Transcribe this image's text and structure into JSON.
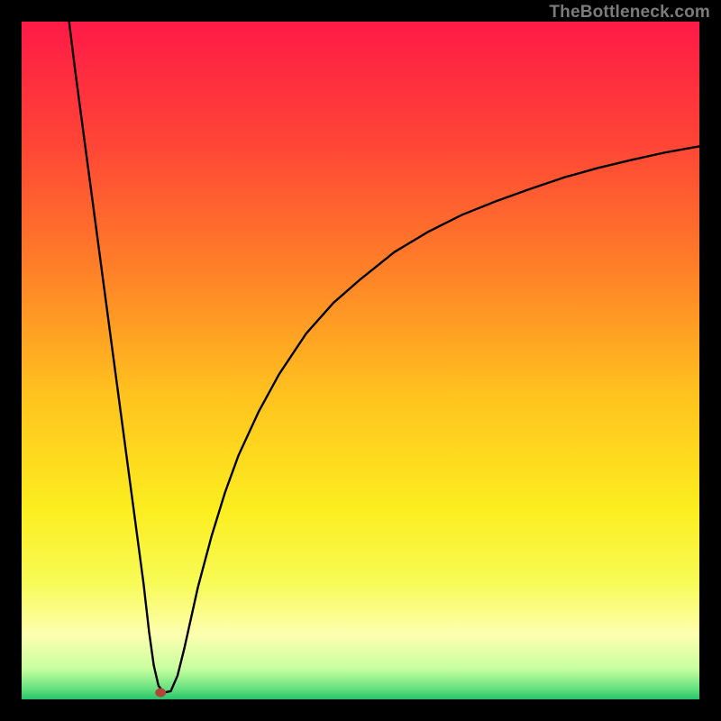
{
  "watermark": "TheBottleneck.com",
  "chart_data": {
    "type": "line",
    "title": "",
    "xlabel": "",
    "ylabel": "",
    "xlim": [
      0,
      100
    ],
    "ylim": [
      0,
      100
    ],
    "grid": false,
    "legend": false,
    "gradient_stops": [
      {
        "offset": 0.0,
        "color": "#ff1a47"
      },
      {
        "offset": 0.18,
        "color": "#ff4536"
      },
      {
        "offset": 0.36,
        "color": "#ff7e28"
      },
      {
        "offset": 0.55,
        "color": "#ffc21e"
      },
      {
        "offset": 0.72,
        "color": "#fcee1f"
      },
      {
        "offset": 0.83,
        "color": "#f7fb58"
      },
      {
        "offset": 0.905,
        "color": "#fdffb0"
      },
      {
        "offset": 0.955,
        "color": "#c7ff9e"
      },
      {
        "offset": 0.985,
        "color": "#63e07e"
      },
      {
        "offset": 1.0,
        "color": "#27c36a"
      }
    ],
    "marker": {
      "x": 20.5,
      "y": 1.0,
      "color": "#b24537"
    },
    "series": [
      {
        "name": "curve",
        "x": [
          7,
          8,
          9,
          10,
          11,
          12,
          13,
          14,
          15,
          16,
          17,
          18,
          18.8,
          19.5,
          20.2,
          21,
          22,
          23,
          24,
          25,
          26,
          28,
          30,
          32,
          35,
          38,
          42,
          46,
          50,
          55,
          60,
          65,
          70,
          75,
          80,
          85,
          90,
          95,
          100
        ],
        "y": [
          100,
          92,
          84.5,
          77,
          69.5,
          62,
          54.5,
          47,
          39.5,
          32,
          24.5,
          17,
          10,
          5,
          2,
          1,
          1.2,
          3.5,
          7.5,
          12,
          16.5,
          24,
          30.5,
          36,
          42.5,
          48,
          54,
          58.5,
          62,
          66,
          69,
          71.5,
          73.5,
          75.3,
          77,
          78.4,
          79.6,
          80.7,
          81.6
        ]
      }
    ]
  }
}
